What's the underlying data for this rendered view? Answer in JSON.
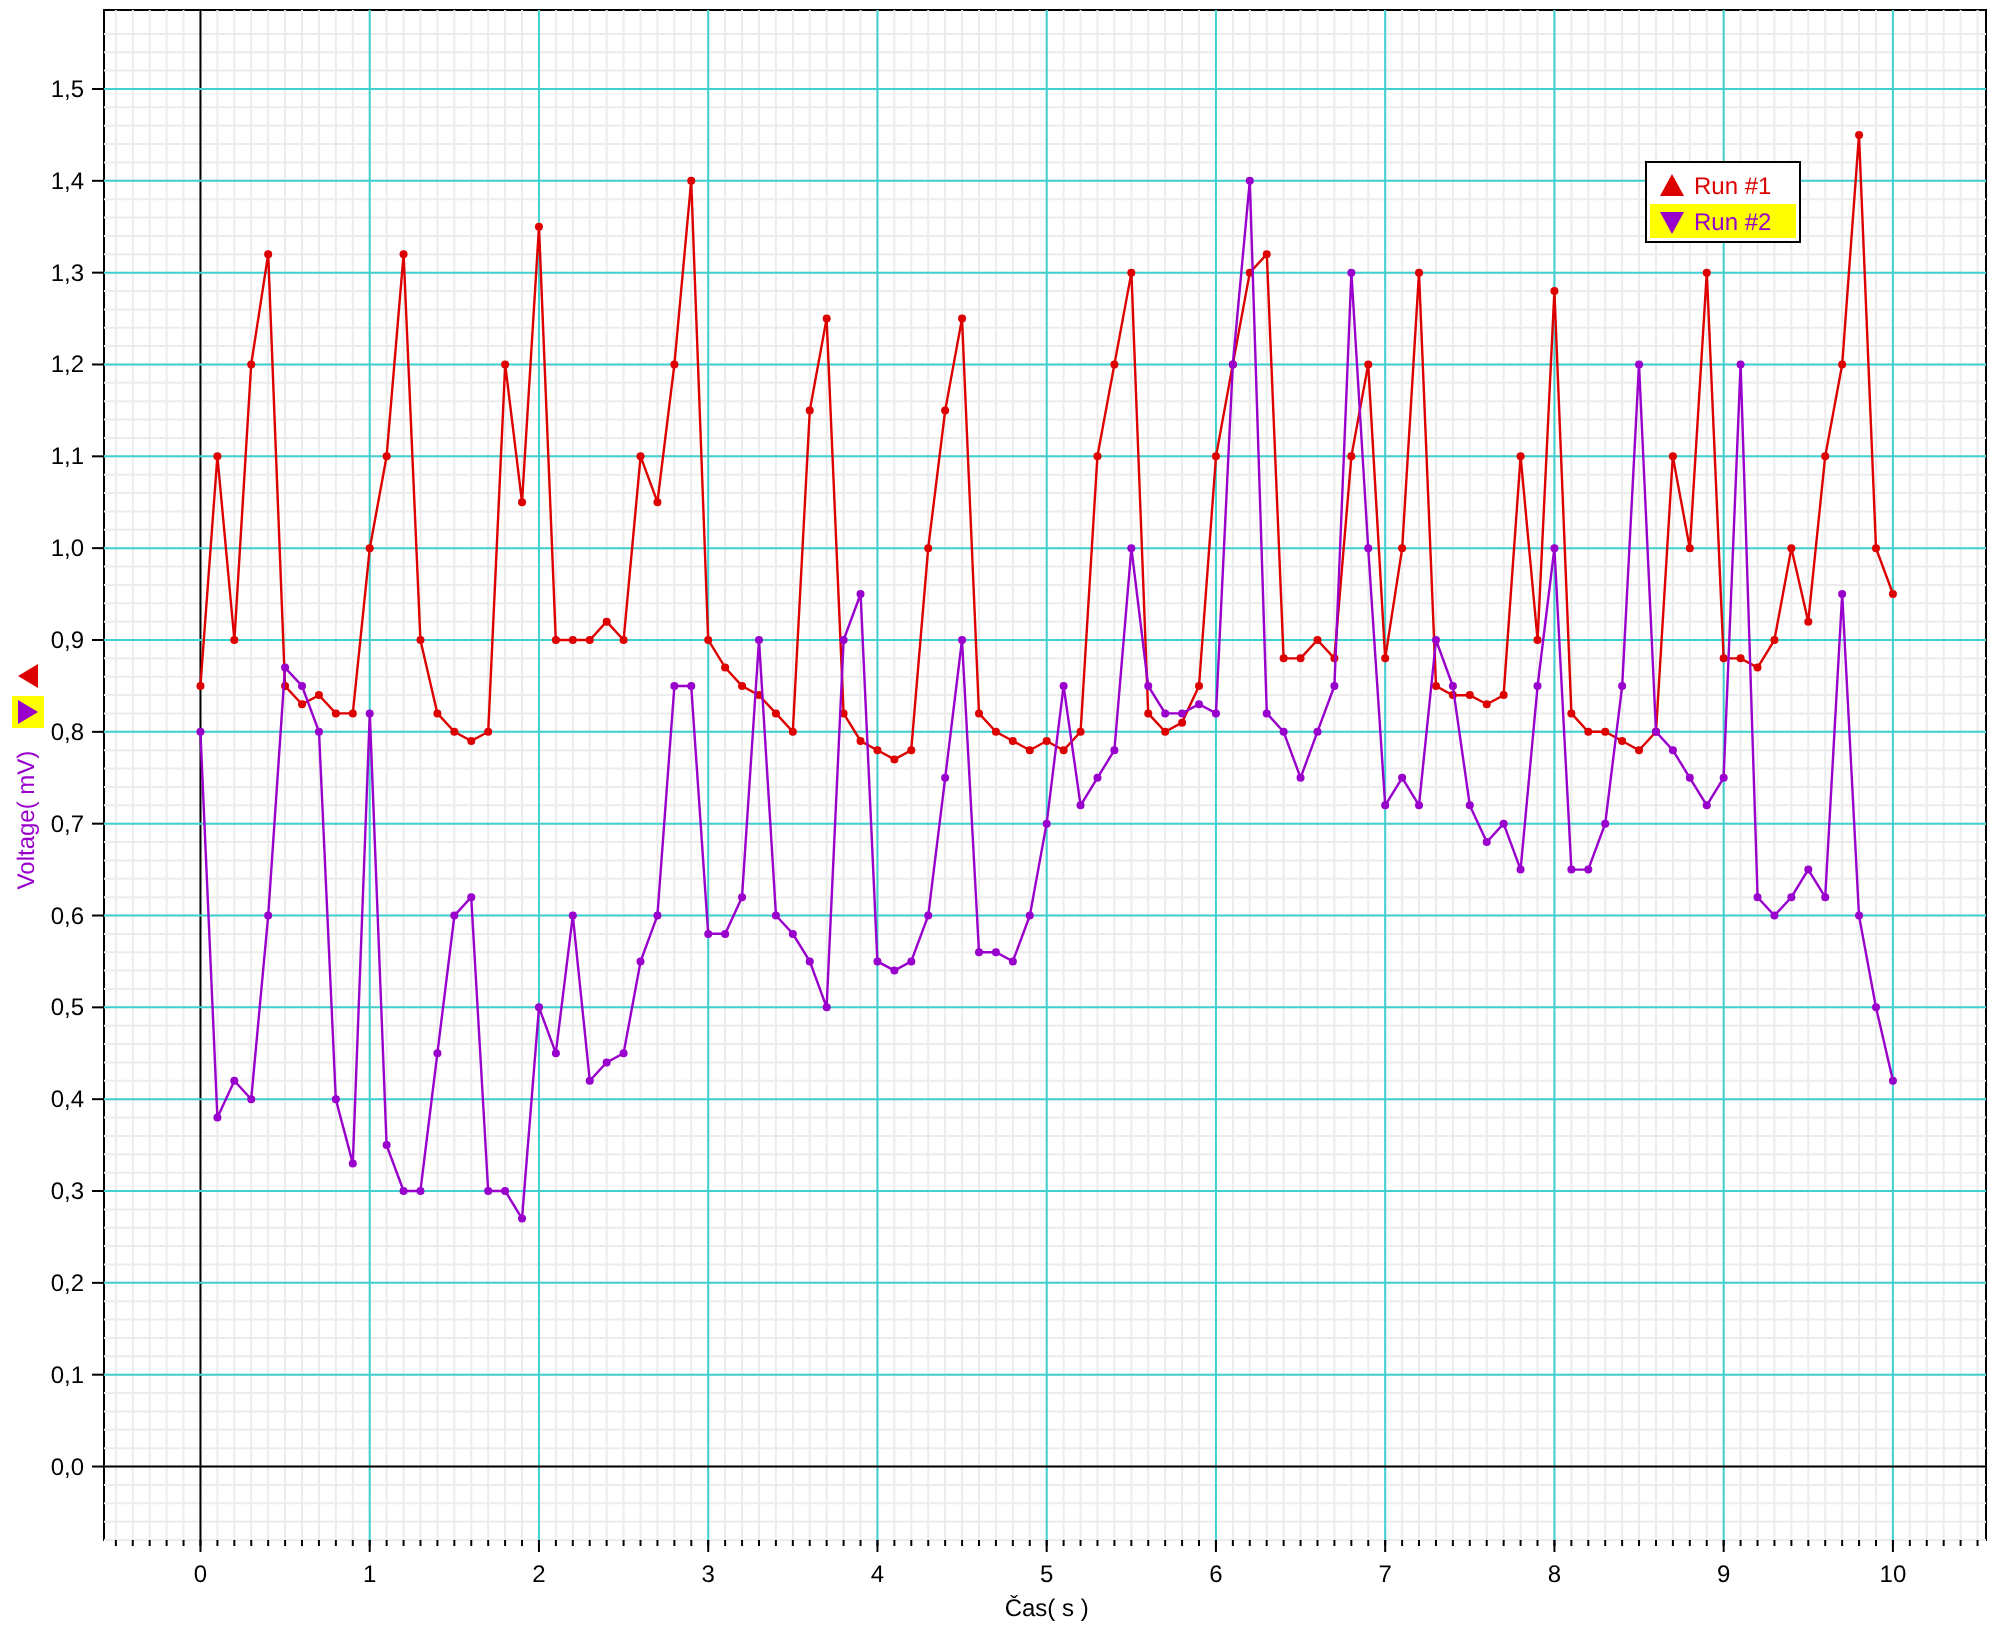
{
  "chart_data": {
    "type": "line",
    "grid": true,
    "legend": true,
    "xlabel": "Čas( s )",
    "ylabel": "Voltage( mV)",
    "xlim": [
      -0.57,
      10.55
    ],
    "ylim": [
      -0.08,
      1.586
    ],
    "xticks": [
      0,
      1,
      2,
      3,
      4,
      5,
      6,
      7,
      8,
      9,
      10
    ],
    "yticks": [
      {
        "value": 0,
        "label": "0,0"
      },
      {
        "value": 0.1,
        "label": "0,1"
      },
      {
        "value": 0.2,
        "label": "0,2"
      },
      {
        "value": 0.3,
        "label": "0,3"
      },
      {
        "value": 0.4,
        "label": "0,4"
      },
      {
        "value": 0.5,
        "label": "0,5"
      },
      {
        "value": 0.6,
        "label": "0,6"
      },
      {
        "value": 0.7,
        "label": "0,7"
      },
      {
        "value": 0.8,
        "label": "0,8"
      },
      {
        "value": 0.9,
        "label": "0,9"
      },
      {
        "value": 1.0,
        "label": "1,0"
      },
      {
        "value": 1.1,
        "label": "1,1"
      },
      {
        "value": 1.2,
        "label": "1,2"
      },
      {
        "value": 1.3,
        "label": "1,3"
      },
      {
        "value": 1.4,
        "label": "1,4"
      },
      {
        "value": 1.5,
        "label": "1,5"
      }
    ],
    "x": [
      0,
      0.1,
      0.2,
      0.3,
      0.4,
      0.5,
      0.6,
      0.7,
      0.8,
      0.9,
      1,
      1.1,
      1.2,
      1.3,
      1.4,
      1.5,
      1.6,
      1.7,
      1.8,
      1.9,
      2,
      2.1,
      2.2,
      2.3,
      2.4,
      2.5,
      2.6,
      2.7,
      2.8,
      2.9,
      3,
      3.1,
      3.2,
      3.3,
      3.4,
      3.5,
      3.6,
      3.7,
      3.8,
      3.9,
      4,
      4.1,
      4.2,
      4.3,
      4.4,
      4.5,
      4.6,
      4.7,
      4.8,
      4.9,
      5,
      5.1,
      5.2,
      5.3,
      5.4,
      5.5,
      5.6,
      5.7,
      5.8,
      5.9,
      6,
      6.1,
      6.2,
      6.3,
      6.4,
      6.5,
      6.6,
      6.7,
      6.8,
      6.9,
      7,
      7.1,
      7.2,
      7.3,
      7.4,
      7.5,
      7.6,
      7.7,
      7.8,
      7.9,
      8,
      8.1,
      8.2,
      8.3,
      8.4,
      8.5,
      8.6,
      8.7,
      8.8,
      8.9,
      9,
      9.1,
      9.2,
      9.3,
      9.4,
      9.5,
      9.6,
      9.7,
      9.8,
      9.9,
      10
    ],
    "series": [
      {
        "name": "Run #1",
        "color": "#dd0000",
        "marker": "circle",
        "values": [
          0.85,
          1.1,
          0.9,
          1.2,
          1.32,
          0.85,
          0.83,
          0.84,
          0.82,
          0.82,
          1.0,
          1.1,
          1.32,
          0.9,
          0.82,
          0.8,
          0.79,
          0.8,
          1.2,
          1.05,
          1.35,
          0.9,
          0.9,
          0.9,
          0.92,
          0.9,
          1.1,
          1.05,
          1.2,
          1.4,
          0.9,
          0.87,
          0.85,
          0.84,
          0.82,
          0.8,
          1.15,
          1.25,
          0.82,
          0.79,
          0.78,
          0.77,
          0.78,
          1.0,
          1.15,
          1.25,
          0.82,
          0.8,
          0.79,
          0.78,
          0.79,
          0.78,
          0.8,
          1.1,
          1.2,
          1.3,
          0.82,
          0.8,
          0.81,
          0.85,
          1.1,
          1.2,
          1.3,
          1.32,
          0.88,
          0.88,
          0.9,
          0.88,
          1.1,
          1.2,
          0.88,
          1.0,
          1.3,
          0.85,
          0.84,
          0.84,
          0.83,
          0.84,
          1.1,
          0.9,
          1.28,
          0.82,
          0.8,
          0.8,
          0.79,
          0.78,
          0.8,
          1.1,
          1.0,
          1.3,
          0.88,
          0.88,
          0.87,
          0.9,
          1.0,
          0.92,
          1.1,
          1.2,
          1.45,
          1.0,
          0.95
        ]
      },
      {
        "name": "Run #2",
        "color": "#9900cc",
        "marker": "circle",
        "values": [
          0.8,
          0.38,
          0.42,
          0.4,
          0.6,
          0.87,
          0.85,
          0.8,
          0.4,
          0.33,
          0.82,
          0.35,
          0.3,
          0.3,
          0.45,
          0.6,
          0.62,
          0.3,
          0.3,
          0.27,
          0.5,
          0.45,
          0.6,
          0.42,
          0.44,
          0.45,
          0.55,
          0.6,
          0.85,
          0.85,
          0.58,
          0.58,
          0.62,
          0.9,
          0.6,
          0.58,
          0.55,
          0.5,
          0.9,
          0.95,
          0.55,
          0.54,
          0.55,
          0.6,
          0.75,
          0.9,
          0.56,
          0.56,
          0.55,
          0.6,
          0.7,
          0.85,
          0.72,
          0.75,
          0.78,
          1.0,
          0.85,
          0.82,
          0.82,
          0.83,
          0.82,
          1.2,
          1.4,
          0.82,
          0.8,
          0.75,
          0.8,
          0.85,
          1.3,
          1.0,
          0.72,
          0.75,
          0.72,
          0.9,
          0.85,
          0.72,
          0.68,
          0.7,
          0.65,
          0.85,
          1.0,
          0.65,
          0.65,
          0.7,
          0.85,
          1.2,
          0.8,
          0.78,
          0.75,
          0.72,
          0.75,
          1.2,
          0.62,
          0.6,
          0.62,
          0.65,
          0.62,
          0.95,
          0.6,
          0.5,
          0.42
        ]
      }
    ]
  },
  "legend": [
    {
      "kind": "up",
      "selected": false
    },
    {
      "kind": "down",
      "selected": true
    }
  ]
}
